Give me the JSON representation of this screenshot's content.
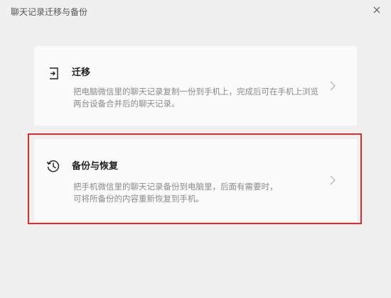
{
  "window": {
    "title": "聊天记录迁移与备份",
    "close_icon": "close-icon"
  },
  "options": [
    {
      "icon": "migrate-icon",
      "title": "迁移",
      "description": "把电脑微信里的聊天记录复制一份到手机上，完成后可在手机上浏览两台设备合并后的聊天记录。",
      "chevron_icon": "chevron-right-icon"
    },
    {
      "icon": "backup-restore-icon",
      "title": "备份与恢复",
      "description_lines": [
        "把手机微信里的聊天记录备份到电脑里，后面有需要时，",
        "可将所备份的内容重新恢复到手机。"
      ],
      "chevron_icon": "chevron-right-icon",
      "highlighted": true
    }
  ],
  "colors": {
    "background": "#f0f0f0",
    "card": "#fbfbfb",
    "highlight": "#e02b2b",
    "text_primary": "#1f1f1f",
    "text_secondary": "#8a8a8a"
  }
}
